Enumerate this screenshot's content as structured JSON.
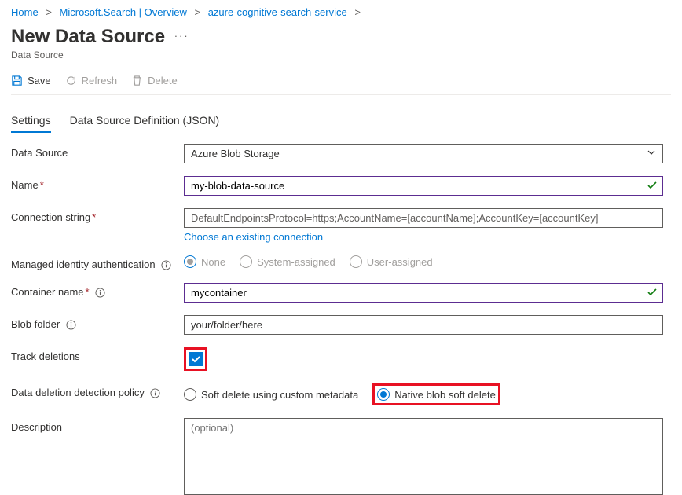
{
  "breadcrumb": {
    "home": "Home",
    "ms_search": "Microsoft.Search | Overview",
    "service": "azure-cognitive-search-service"
  },
  "header": {
    "title": "New Data Source",
    "subtitle": "Data Source"
  },
  "toolbar": {
    "save": "Save",
    "refresh": "Refresh",
    "delete": "Delete"
  },
  "tabs": {
    "settings": "Settings",
    "json": "Data Source Definition (JSON)"
  },
  "form": {
    "data_source": {
      "label": "Data Source",
      "value": "Azure Blob Storage"
    },
    "name": {
      "label": "Name",
      "value": "my-blob-data-source"
    },
    "conn": {
      "label": "Connection string",
      "value": "DefaultEndpointsProtocol=https;AccountName=[accountName];AccountKey=[accountKey]",
      "helper": "Choose an existing connection"
    },
    "managed_identity": {
      "label": "Managed identity authentication",
      "none": "None",
      "system": "System-assigned",
      "user": "User-assigned"
    },
    "container": {
      "label": "Container name",
      "value": "mycontainer"
    },
    "blob_folder": {
      "label": "Blob folder",
      "value": "your/folder/here"
    },
    "track_deletions": {
      "label": "Track deletions"
    },
    "deletion_policy": {
      "label": "Data deletion detection policy",
      "soft_custom": "Soft delete using custom metadata",
      "native": "Native blob soft delete"
    },
    "description": {
      "label": "Description",
      "placeholder": "(optional)"
    }
  }
}
